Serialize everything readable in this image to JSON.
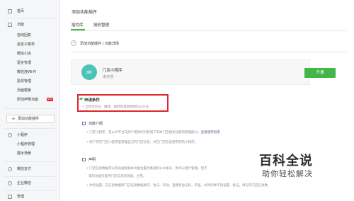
{
  "sidebar": {
    "home": "首页",
    "function_section": "功能",
    "items": [
      "自动回复",
      "自定义菜单",
      "微信小店",
      "留言管理",
      "微信连Wi-Fi",
      "投票管理",
      "页面模板",
      "原创声明功能"
    ],
    "badge": "NEW",
    "add_plugin": "添加功能插件",
    "mini_section": "小程序",
    "mini_items": [
      "小程序管理",
      "展示场景"
    ],
    "pay": "微信支付",
    "enterprise": "企业微信",
    "manage": "管理"
  },
  "main": {
    "page_title": "添加功能插件",
    "tabs": [
      "插件库",
      "授权管理"
    ],
    "breadcrumb": "添加功能插件 / 功能详情",
    "plugin": {
      "name": "门店小程序",
      "status": "未开通",
      "open_button": "开通"
    },
    "conditions": {
      "title": "申请条件",
      "text": "• 全体为企业、媒体、政府和其他组织的公众号"
    },
    "intro": {
      "title": "功能介绍",
      "line1": "• 门店小程序，是公众平台向商户提供的对其线下实体门店相关功能的管理能力。",
      "link": "查看使用指南",
      "line2": "• 商户可在门店小程序里管理自己的门店信息，并在门店信息使用到的小程序。"
    },
    "statement": {
      "title": "声明",
      "line1": "• 门店信息数据库以及设备根据本功能位置为基础的公众帐号，你可以进行管理，但不",
      "line2": "得的功能仅提供门店信息的功能，占用。",
      "line3": "• 你的位置，在信息数据库门店信息数据真实、合法、有效，且拥有合法权，审查，并对的事不的设置、标记，填写的门店信息数"
    }
  },
  "watermark": {
    "title": "百科全说",
    "subtitle": "助你轻松解决"
  },
  "colors": {
    "accent": "#44b549",
    "highlight_box": "#e0242a",
    "link": "#576b95"
  }
}
